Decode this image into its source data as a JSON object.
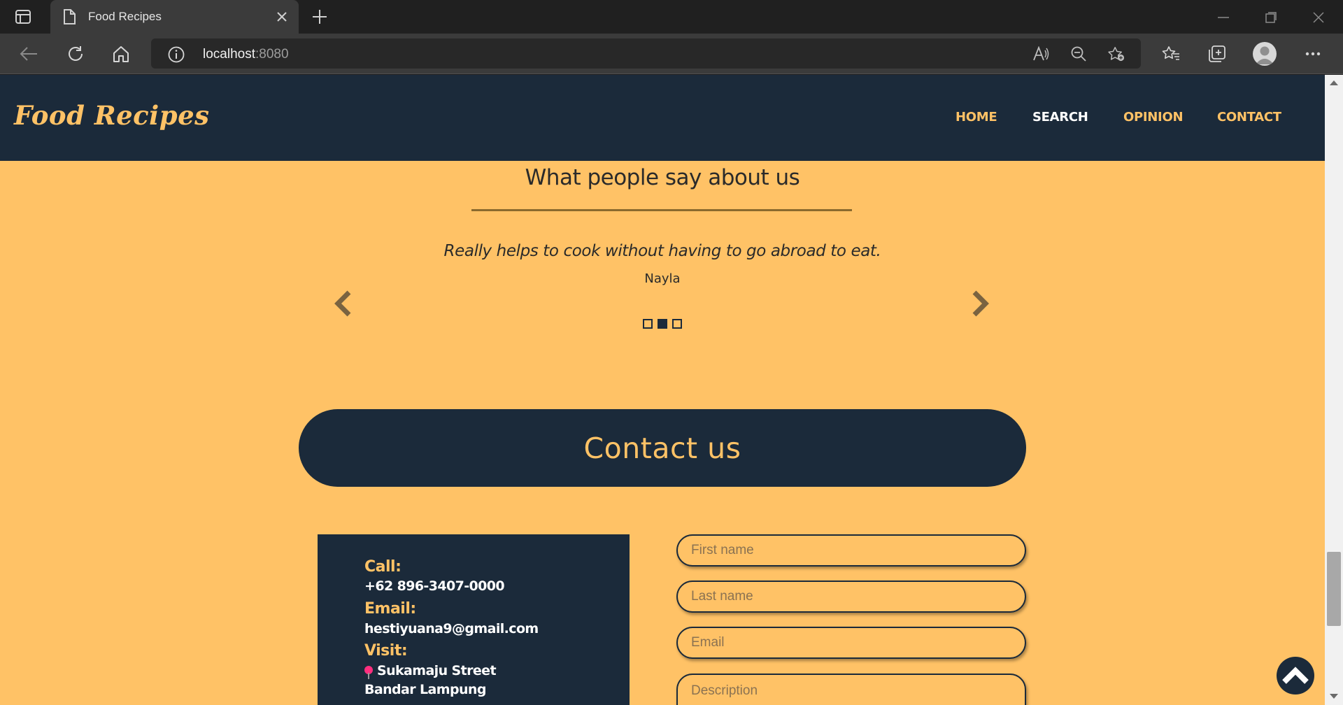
{
  "browser": {
    "tab_title": "Food Recipes",
    "url_host": "localhost",
    "url_port": ":8080"
  },
  "site": {
    "logo": "Food Recipes",
    "nav": [
      {
        "label": "HOME",
        "active": false
      },
      {
        "label": "SEARCH",
        "active": true
      },
      {
        "label": "OPINION",
        "active": false
      },
      {
        "label": "CONTACT",
        "active": false
      }
    ]
  },
  "testimonials": {
    "title": "What people say about us",
    "quote": "Really helps to cook without having to go abroad to eat.",
    "author": "Nayla",
    "indicators": [
      false,
      true,
      false
    ]
  },
  "contact": {
    "banner": "Contact us",
    "call_label": "Call:",
    "call_value": "+62 896-3407-0000",
    "email_label": "Email:",
    "email_value": "hestiyuana9@gmail.com",
    "visit_label": "Visit:",
    "visit_street": "Sukamaju Street",
    "visit_city": "Bandar Lampung",
    "form": {
      "first_name_placeholder": "First name",
      "last_name_placeholder": "Last name",
      "email_placeholder": "Email",
      "description_placeholder": "Description"
    }
  },
  "colors": {
    "navy": "#1b2a3a",
    "accent": "#ffc266",
    "page_bg": "#ffc266"
  },
  "icons": [
    "tab-actions-icon",
    "page-icon",
    "close-icon",
    "plus-icon",
    "minimize-icon",
    "restore-icon",
    "back-icon",
    "refresh-icon",
    "home-icon",
    "info-icon",
    "read-aloud-icon",
    "zoom-out-icon",
    "add-favorite-icon",
    "favorites-icon",
    "collections-icon",
    "profile-icon",
    "more-icon",
    "chevron-left-icon",
    "chevron-right-icon",
    "chevron-up-icon",
    "pin-icon"
  ]
}
